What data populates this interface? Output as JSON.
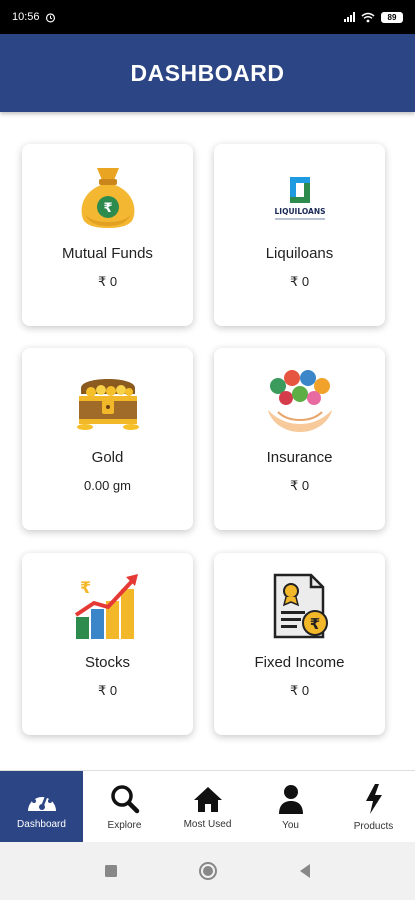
{
  "status_bar": {
    "time": "10:56",
    "battery": "89"
  },
  "header": {
    "title": "DASHBOARD"
  },
  "cards": [
    {
      "title": "Mutual Funds",
      "value": "₹ 0",
      "icon": "money-bag-icon"
    },
    {
      "title": "Liquiloans",
      "value": "₹ 0",
      "icon": "liquiloans-logo",
      "logo_text": "LIQUILOANS"
    },
    {
      "title": "Gold",
      "value": "0.00 gm",
      "icon": "treasure-chest-icon"
    },
    {
      "title": "Insurance",
      "value": "₹ 0",
      "icon": "insurance-hands-icon"
    },
    {
      "title": "Stocks",
      "value": "₹ 0",
      "icon": "stocks-chart-icon"
    },
    {
      "title": "Fixed Income",
      "value": "₹ 0",
      "icon": "fixed-income-document-icon"
    }
  ],
  "bottom_nav": [
    {
      "label": "Dashboard",
      "icon": "speedometer-icon",
      "active": true
    },
    {
      "label": "Explore",
      "icon": "search-icon",
      "active": false
    },
    {
      "label": "Most Used",
      "icon": "home-icon",
      "active": false
    },
    {
      "label": "You",
      "icon": "user-icon",
      "active": false
    },
    {
      "label": "Products",
      "icon": "lightning-icon",
      "active": false
    }
  ],
  "colors": {
    "primary": "#2c4585",
    "gold": "#f3b72a",
    "green": "#2e8b4e"
  }
}
